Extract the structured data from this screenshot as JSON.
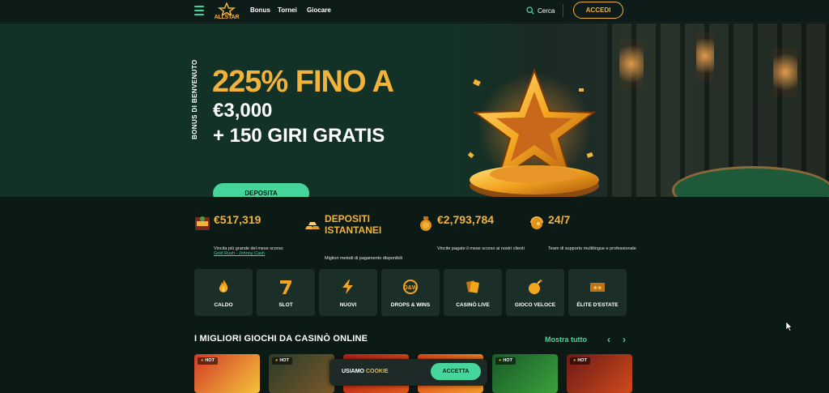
{
  "header": {
    "logo_text": "ALLSTAR",
    "nav": [
      "Bonus",
      "Tornei",
      "Giocare"
    ],
    "search_label": "Cerca",
    "login_label": "ACCEDI"
  },
  "hero": {
    "side_label": "BONUS DI BENVENUTO",
    "title": "225% FINO A",
    "line2": "€3,000",
    "line3": "+ 150 GIRI GRATIS",
    "cta": "DEPOSITA",
    "slides_count": 7,
    "active_slide": 1
  },
  "stats": [
    {
      "value": "€517,319",
      "desc": "Vincita più grande del mese scorso",
      "link": "Gold Rush - Johnny Cash",
      "icon": "slot-game-icon"
    },
    {
      "value": "DEPOSITI ISTANTANEI",
      "desc": "Migliori metodi di pagamento disponibili",
      "icon": "gold-bars-icon"
    },
    {
      "value": "€2,793,784",
      "desc": "Vincite pagate il mese scorso ai nostri clienti",
      "icon": "coin-bag-icon"
    },
    {
      "value": "24/7",
      "desc": "Team di supporto multilingue e professionale",
      "icon": "support-icon"
    }
  ],
  "categories": [
    {
      "label": "CALDO",
      "icon": "flame-icon"
    },
    {
      "label": "SLOT",
      "icon": "seven-icon"
    },
    {
      "label": "NUOVI",
      "icon": "lightning-icon"
    },
    {
      "label": "DROPS & WINS",
      "icon": "drops-wins-icon"
    },
    {
      "label": "CASINÒ LIVE",
      "icon": "live-cards-icon"
    },
    {
      "label": "GIOCO VELOCE",
      "icon": "bomb-icon"
    },
    {
      "label": "ÉLITE D'ESTATE",
      "icon": "elite-icon"
    }
  ],
  "games_section": {
    "title": "I MIGLIORI GIOCHI DA CASINÒ ONLINE",
    "show_all": "Mostra tutto",
    "badge": "HOT",
    "games": [
      {
        "colors": [
          "#d23a2a",
          "#f5c23a"
        ],
        "hot": true
      },
      {
        "colors": [
          "#2a3a2a",
          "#7a5a2a"
        ],
        "hot": true
      },
      {
        "colors": [
          "#b8201a",
          "#e05a1a"
        ],
        "hot": false
      },
      {
        "colors": [
          "#e04a1a",
          "#f39a2a"
        ],
        "hot": false
      },
      {
        "colors": [
          "#1a5a2a",
          "#3aa03a"
        ],
        "hot": true
      },
      {
        "colors": [
          "#6a1a1a",
          "#d04a1a"
        ],
        "hot": true
      }
    ]
  },
  "cookie": {
    "prefix": "USIAMO",
    "link": "COOKIE",
    "accept": "ACCETTA"
  },
  "colors": {
    "accent_gold": "#f3b23a",
    "accent_green": "#46d69c",
    "bg": "#0c1a16",
    "hero_bg": "#133227"
  }
}
